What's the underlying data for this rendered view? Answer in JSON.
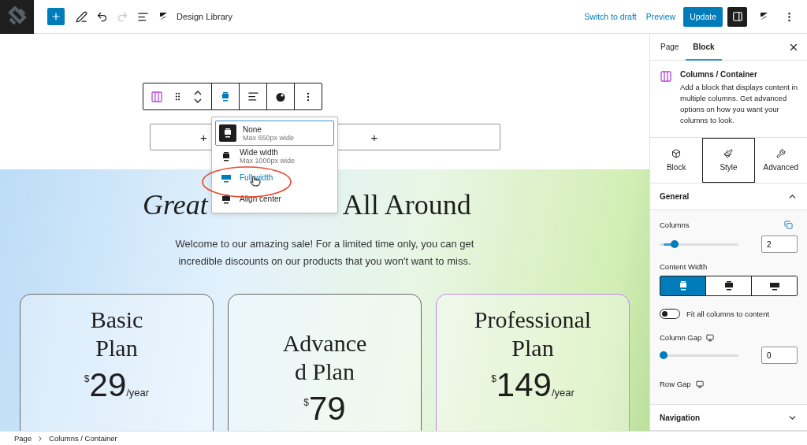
{
  "topbar": {
    "title": "Design Library",
    "redo_disabled": true,
    "actions": [
      {
        "label": "Switch to draft",
        "kind": "link"
      },
      {
        "label": "Preview",
        "kind": "link"
      },
      {
        "label": "Update",
        "kind": "primary"
      }
    ]
  },
  "canvas": {
    "placeholder_buttons": [
      "+",
      "+"
    ],
    "width_menu": {
      "options": [
        {
          "label": "None",
          "hint": "Max 650px wide",
          "selected": true,
          "hovered": false
        },
        {
          "label": "Wide width",
          "hint": "Max 1000px wide",
          "selected": false,
          "hovered": false
        },
        {
          "label": "Full width",
          "selected": false,
          "hovered": true
        },
        {
          "label": "Align center",
          "selected": false,
          "hovered": false
        }
      ]
    },
    "section": {
      "heading_parts": [
        "Great",
        "All Around"
      ],
      "intro": "Welcome to our amazing sale! For a limited time only, you can get incredible discounts on our products that you won't want to miss.",
      "plans": [
        {
          "name_lines": [
            "Basic",
            "Plan"
          ],
          "currency": "$",
          "price": "29",
          "period": "/year",
          "selected": false
        },
        {
          "name_lines": [
            "Advance",
            "d Plan"
          ],
          "currency": "$",
          "price": "79",
          "selected": false
        },
        {
          "name_lines": [
            "Professional",
            "Plan"
          ],
          "currency": "$",
          "price": "149",
          "period": "/year",
          "selected": true
        }
      ]
    }
  },
  "sidebar": {
    "tabs": [
      {
        "label": "Page",
        "selected": false
      },
      {
        "label": "Block",
        "selected": true
      }
    ],
    "block": {
      "title": "Columns / Container",
      "description": "Add a block that displays content in multiple columns. Get advanced options on how you want your columns to look."
    },
    "panel_tabs": [
      {
        "label": "Block",
        "kind": "block",
        "selected": false
      },
      {
        "label": "Style",
        "kind": "style",
        "selected": true
      },
      {
        "label": "Advanced",
        "kind": "advanced",
        "selected": false
      }
    ],
    "general": {
      "title": "General",
      "expanded": true,
      "columns": {
        "label": "Columns",
        "level": 0.15,
        "value": "2"
      },
      "content_width": {
        "label": "Content Width",
        "options": [
          {
            "selected": true
          },
          {
            "selected": false
          },
          {
            "selected": false
          }
        ]
      },
      "fit": {
        "label": "Fit all columns to content",
        "on": false
      },
      "column_gap": {
        "label": "Column Gap",
        "level": 0,
        "value": "0"
      },
      "row_gap": {
        "label": "Row Gap"
      }
    },
    "navigation": {
      "title": "Navigation",
      "expanded": false
    }
  },
  "breadcrumb": [
    "Page",
    "Columns / Container"
  ]
}
